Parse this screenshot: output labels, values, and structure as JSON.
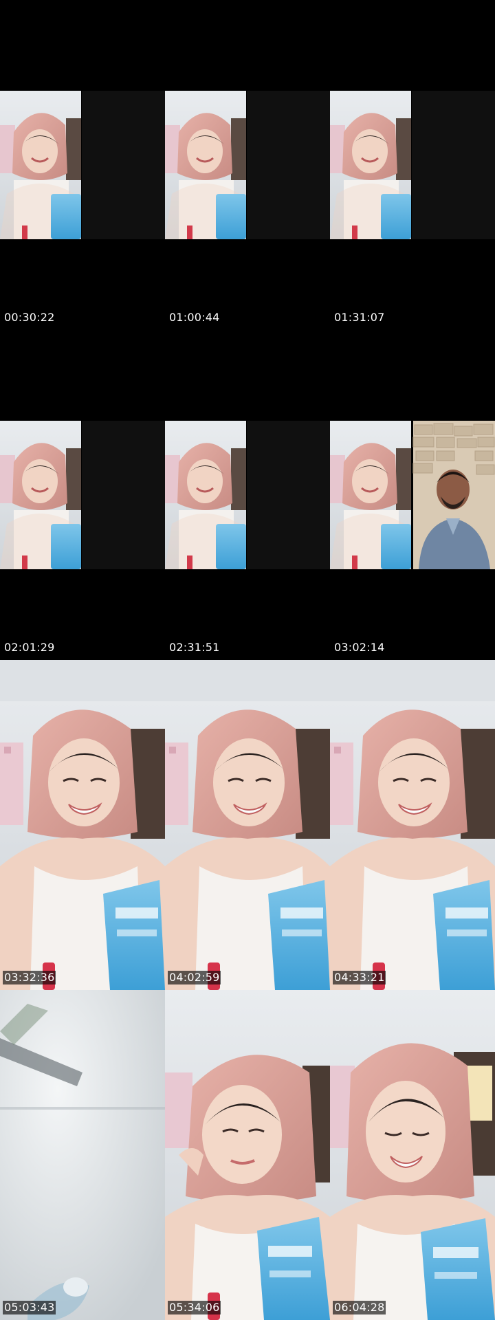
{
  "colors": {
    "background": "#000000",
    "timestamp_text": "#ffffff"
  },
  "frames": [
    {
      "timestamp": "00:30:22",
      "scene": "split-call-blank"
    },
    {
      "timestamp": "01:00:44",
      "scene": "split-call-blank"
    },
    {
      "timestamp": "01:31:07",
      "scene": "split-call-blank"
    },
    {
      "timestamp": "02:01:29",
      "scene": "split-call-blank"
    },
    {
      "timestamp": "02:31:51",
      "scene": "split-call-blank"
    },
    {
      "timestamp": "03:02:14",
      "scene": "split-call-man"
    },
    {
      "timestamp": "03:32:36",
      "scene": "fullscreen-woman-product"
    },
    {
      "timestamp": "04:02:59",
      "scene": "fullscreen-woman-product"
    },
    {
      "timestamp": "04:33:21",
      "scene": "fullscreen-woman-product"
    },
    {
      "timestamp": "05:03:43",
      "scene": "fullscreen-blurred-ceiling"
    },
    {
      "timestamp": "05:34:06",
      "scene": "fullscreen-woman-product-closeup"
    },
    {
      "timestamp": "06:04:28",
      "scene": "fullscreen-woman-closeup"
    }
  ]
}
